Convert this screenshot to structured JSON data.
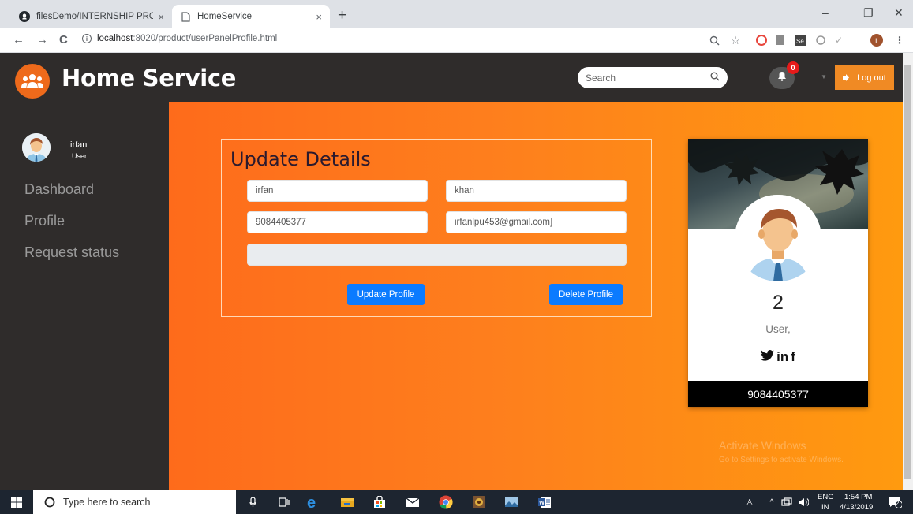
{
  "browser": {
    "tabs": [
      {
        "title": "filesDemo/INTERNSHIP PROJECT",
        "close": "×"
      },
      {
        "title": "HomeService",
        "close": "×"
      }
    ],
    "new_tab": "+",
    "window_controls": {
      "minimize": "–",
      "restore": "❐",
      "close": "✕"
    },
    "nav": {
      "back": "←",
      "forward": "→",
      "reload": "C"
    },
    "url_host": "localhost",
    "url_path": ":8020/product/userPanelProfile.html"
  },
  "header": {
    "brand": "Home Service",
    "search_placeholder": "Search",
    "notification_count": "0",
    "logout_label": "Log out"
  },
  "sidebar": {
    "user_name": "irfan",
    "user_role": "User",
    "links": [
      "Dashboard",
      "Profile",
      "Request status"
    ]
  },
  "form": {
    "title": "Update Details",
    "first_name": "irfan",
    "last_name": "khan",
    "phone": "9084405377",
    "email": "irfanlpu453@gmail.com]",
    "extra": "",
    "update_label": "Update Profile",
    "delete_label": "Delete Profile"
  },
  "profile_card": {
    "number": "2",
    "role": "User,",
    "social": {
      "twitter": "🐦",
      "linkedin": "in",
      "facebook": "f"
    },
    "phone": "9084405377"
  },
  "watermark": {
    "title": "Activate Windows",
    "subtitle": "Go to Settings to activate Windows."
  },
  "taskbar": {
    "search_placeholder": "Type here to search",
    "lang_top": "ENG",
    "lang_bottom": "IN",
    "time": "1:54 PM",
    "date": "4/13/2019",
    "notif_count": "2"
  },
  "colors": {
    "brand_orange": "#ee6a1b",
    "nav_dark": "#2f2c2b",
    "gradient_start": "#fe6b1b",
    "gradient_end": "#ff9a0f",
    "button_blue": "#0b7bff"
  }
}
